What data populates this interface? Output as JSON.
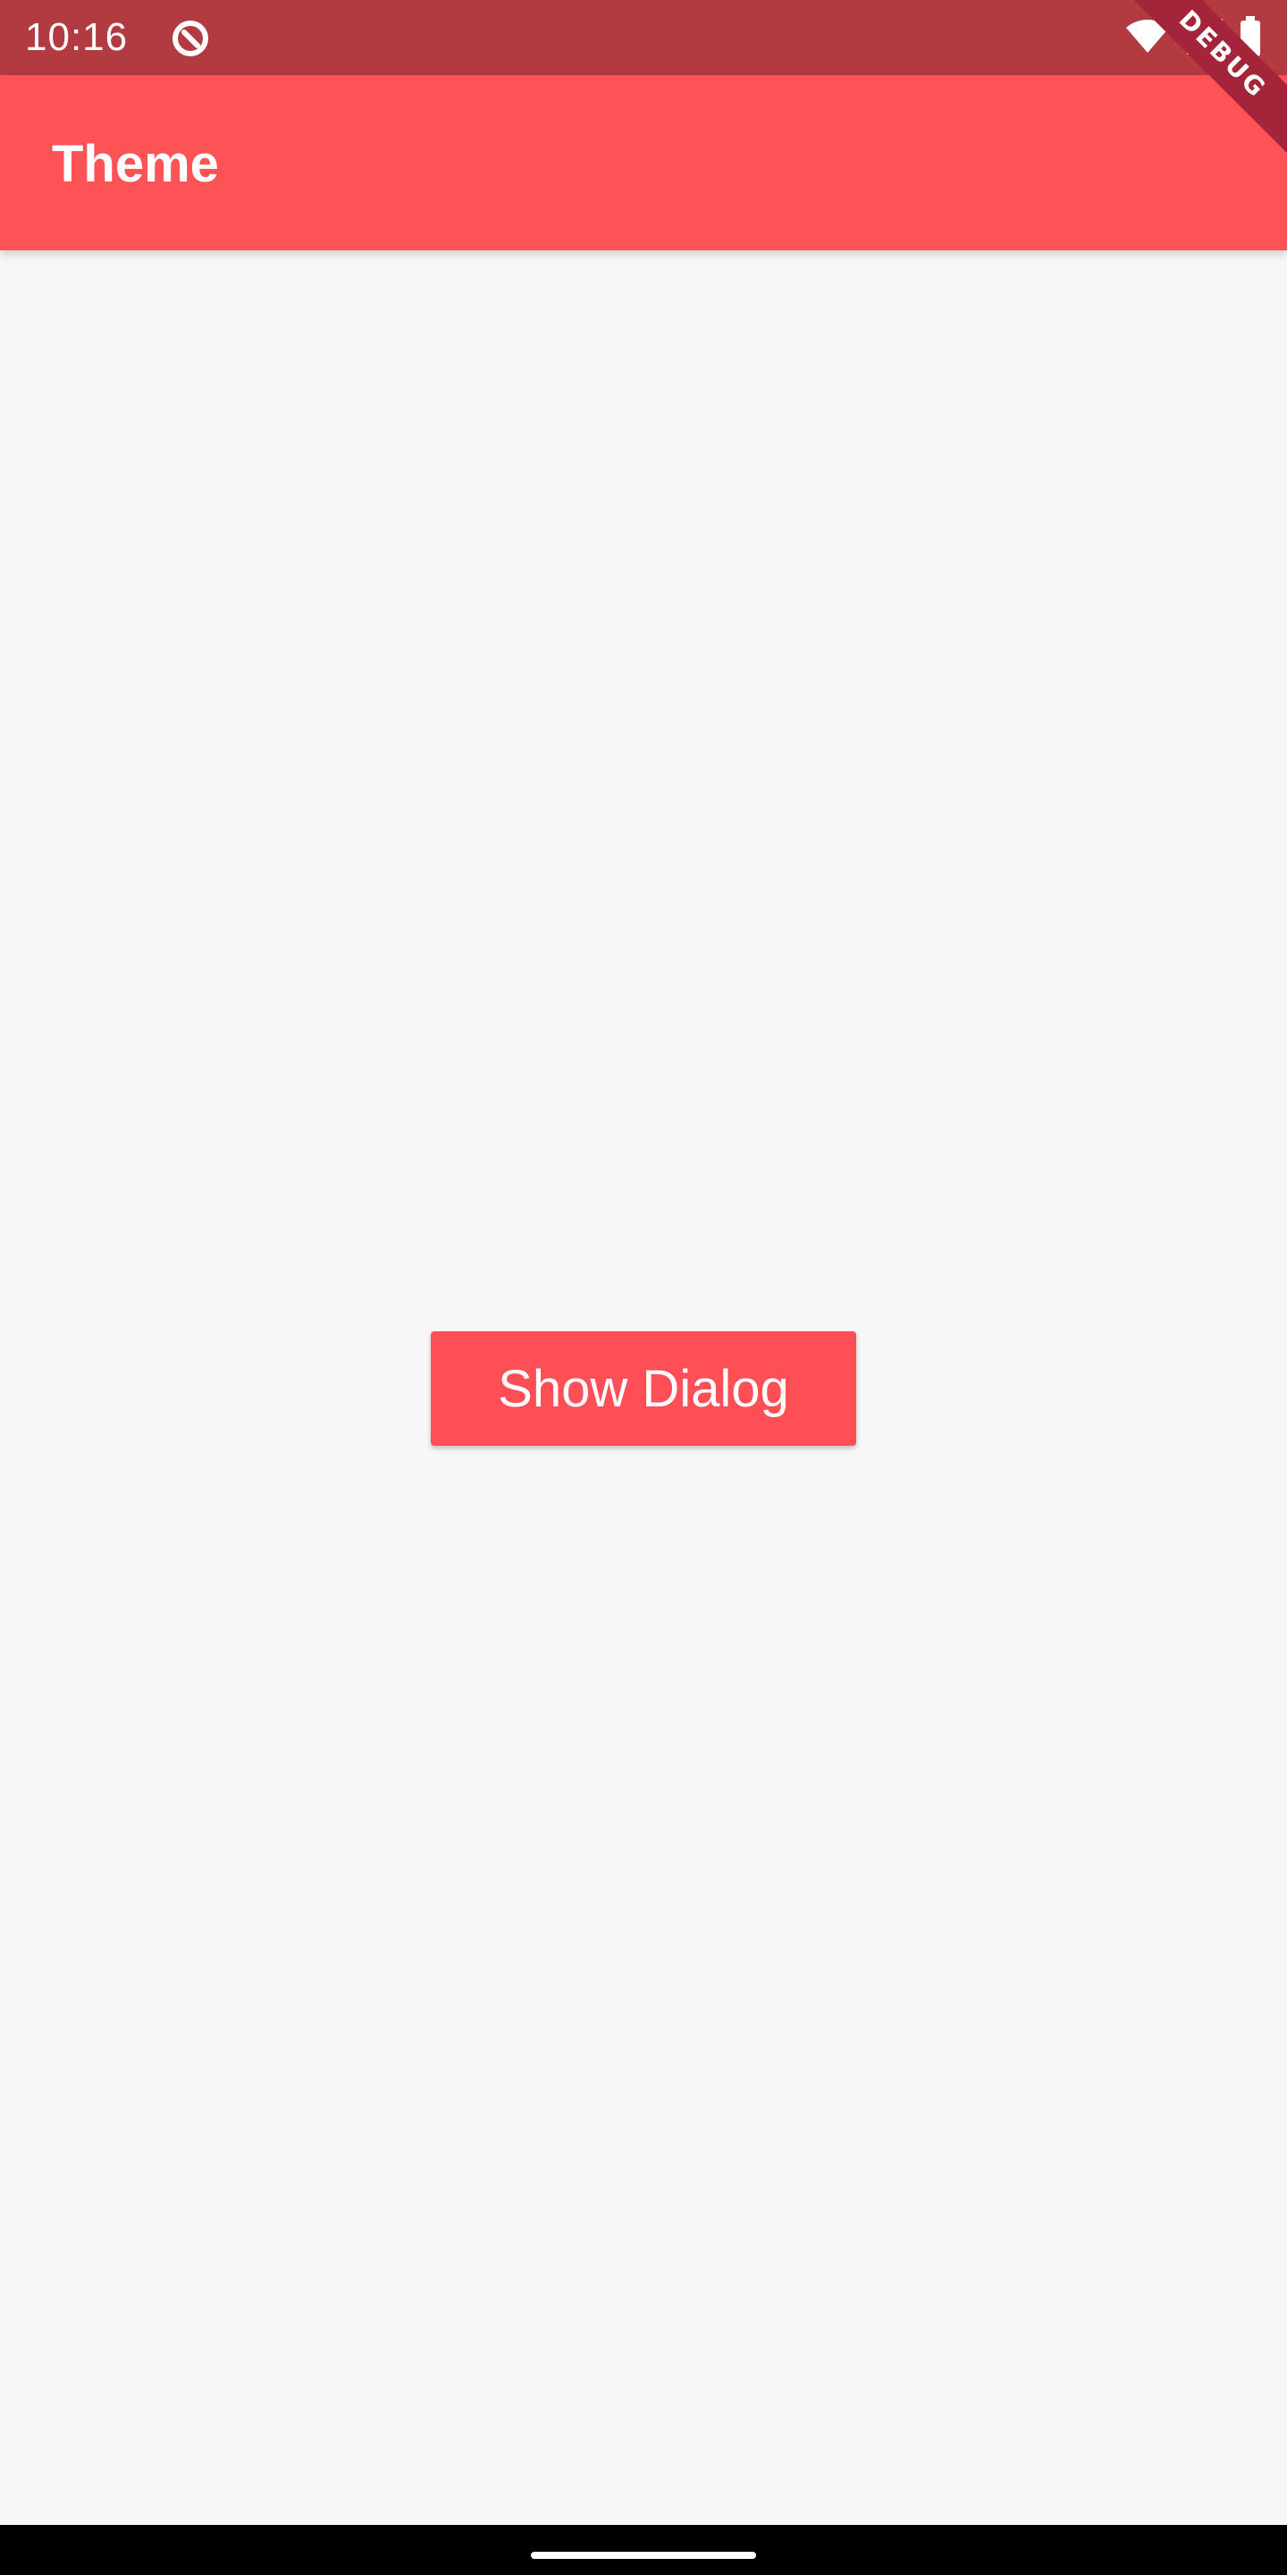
{
  "status_bar": {
    "time": "10:16",
    "app_icon": "app-notification-icon",
    "icons": [
      "wifi-icon",
      "cellular-signal-icon",
      "battery-icon"
    ]
  },
  "app_bar": {
    "title": "Theme"
  },
  "debug_banner": {
    "label": "DEBUG"
  },
  "main": {
    "button_label": "Show Dialog"
  },
  "colors": {
    "status_bar": "#b23b42",
    "app_bar": "#fe5356",
    "button": "#fe4e56",
    "background": "#f8f7f8",
    "debug_banner": "#a4243a"
  }
}
